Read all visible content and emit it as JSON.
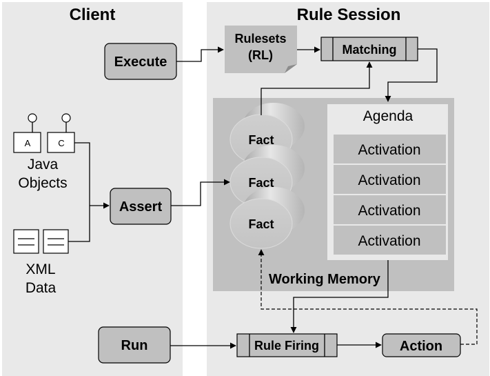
{
  "panels": {
    "client_title": "Client",
    "session_title": "Rule Session"
  },
  "client": {
    "execute_label": "Execute",
    "assert_label": "Assert",
    "run_label": "Run",
    "java_objects": {
      "icons": [
        "A",
        "C"
      ],
      "label_line1": "Java",
      "label_line2": "Objects"
    },
    "xml_data": {
      "label_line1": "XML",
      "label_line2": "Data"
    }
  },
  "session": {
    "rulesets": {
      "line1": "Rulesets",
      "line2": "(RL)"
    },
    "matching_label": "Matching",
    "working_memory_label": "Working Memory",
    "facts": [
      "Fact",
      "Fact",
      "Fact"
    ],
    "agenda": {
      "title": "Agenda",
      "activations": [
        "Activation",
        "Activation",
        "Activation",
        "Activation"
      ]
    },
    "rule_firing_label": "Rule Firing",
    "action_label": "Action"
  },
  "colors": {
    "panel_bg": "#e9e9e9",
    "box_fill": "#c0c0c0",
    "line": "#000000",
    "background": "#ffffff"
  }
}
